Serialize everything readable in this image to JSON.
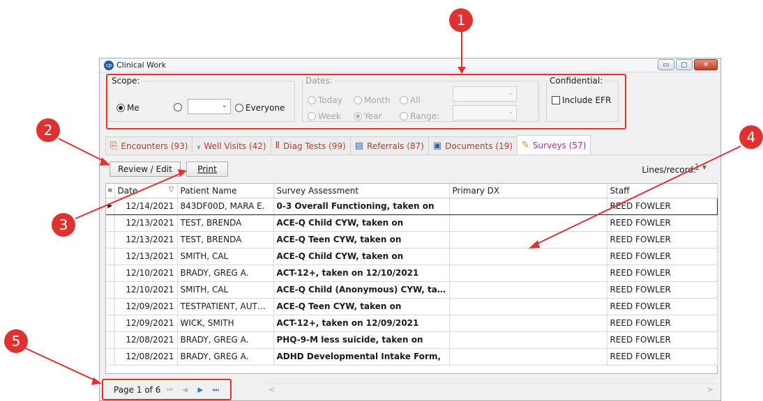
{
  "window": {
    "title": "Clinical Work",
    "app_icon_text": "cp",
    "minimize": "▭",
    "maximize": "▢",
    "close": "✕"
  },
  "scope": {
    "legend": "Scope:",
    "me_label": "Me",
    "everyone_label": "Everyone"
  },
  "dates": {
    "legend": "Dates:",
    "today": "Today",
    "month": "Month",
    "all": "All",
    "week": "Week",
    "year": "Year",
    "range": "Range:"
  },
  "confidential": {
    "legend": "Confidential:",
    "include_efr": "Include EFR"
  },
  "tabs": [
    {
      "label": "Encounters (93)",
      "icon": "encounters-icon",
      "glyph": "⎘"
    },
    {
      "label": "Well Visits (42)",
      "icon": "stethoscope-icon",
      "glyph": "ᵧ"
    },
    {
      "label": "Diag Tests (99)",
      "icon": "test-tubes-icon",
      "glyph": "Ⅱ"
    },
    {
      "label": "Referrals (87)",
      "icon": "referral-card-icon",
      "glyph": "▤"
    },
    {
      "label": "Documents (19)",
      "icon": "documents-icon",
      "glyph": "▣"
    },
    {
      "label": "Surveys (57)",
      "icon": "survey-pencil-icon",
      "glyph": "✎"
    }
  ],
  "toolbar": {
    "review_edit": "Review / Edit",
    "print": "Print",
    "lines_record": "Lines/record:",
    "lines_value": "1"
  },
  "grid": {
    "headers": {
      "date": "Date",
      "patient": "Patient Name",
      "survey": "Survey Assessment",
      "primary_dx": "Primary DX",
      "staff": "Staff"
    },
    "rows": [
      {
        "date": "12/14/2021",
        "patient": "843DF00D, MARA E.",
        "survey": "0-3 Overall Functioning, taken on",
        "dx": "",
        "staff": "REED FOWLER"
      },
      {
        "date": "12/13/2021",
        "patient": "TEST, BRENDA",
        "survey": "ACE-Q Child CYW, taken on",
        "dx": "",
        "staff": "REED FOWLER"
      },
      {
        "date": "12/13/2021",
        "patient": "TEST, BRENDA",
        "survey": "ACE-Q Teen CYW, taken on",
        "dx": "",
        "staff": "REED FOWLER"
      },
      {
        "date": "12/13/2021",
        "patient": "SMITH, CAL",
        "survey": "ACE-Q Child CYW, taken on",
        "dx": "",
        "staff": "REED FOWLER"
      },
      {
        "date": "12/10/2021",
        "patient": "BRADY, GREG A.",
        "survey": "ACT-12+, taken on 12/10/2021",
        "dx": "",
        "staff": "REED FOWLER"
      },
      {
        "date": "12/10/2021",
        "patient": "SMITH, CAL",
        "survey": "ACE-Q Child (Anonymous) CYW, taken",
        "dx": "",
        "staff": "REED FOWLER"
      },
      {
        "date": "12/09/2021",
        "patient": "TESTPATIENT, AUTO...",
        "survey": "ACE-Q Teen CYW, taken on",
        "dx": "",
        "staff": "REED FOWLER"
      },
      {
        "date": "12/09/2021",
        "patient": "WICK, SMITH",
        "survey": "ACT-12+, taken on 12/09/2021",
        "dx": "",
        "staff": "REED FOWLER"
      },
      {
        "date": "12/08/2021",
        "patient": "BRADY, GREG A.",
        "survey": "PHQ-9-M less suicide, taken on",
        "dx": "",
        "staff": "REED FOWLER"
      },
      {
        "date": "12/08/2021",
        "patient": "BRADY, GREG A.",
        "survey": "ADHD Developmental Intake Form,",
        "dx": "",
        "staff": "REED FOWLER"
      }
    ]
  },
  "pager": {
    "label": "Page 1 of 6"
  },
  "callouts": {
    "c1": "1",
    "c2": "2",
    "c3": "3",
    "c4": "4",
    "c5": "5"
  },
  "colors": {
    "callout": "#e03131",
    "tab_text": "#c0392b",
    "active_tab_text": "#b5289c"
  }
}
